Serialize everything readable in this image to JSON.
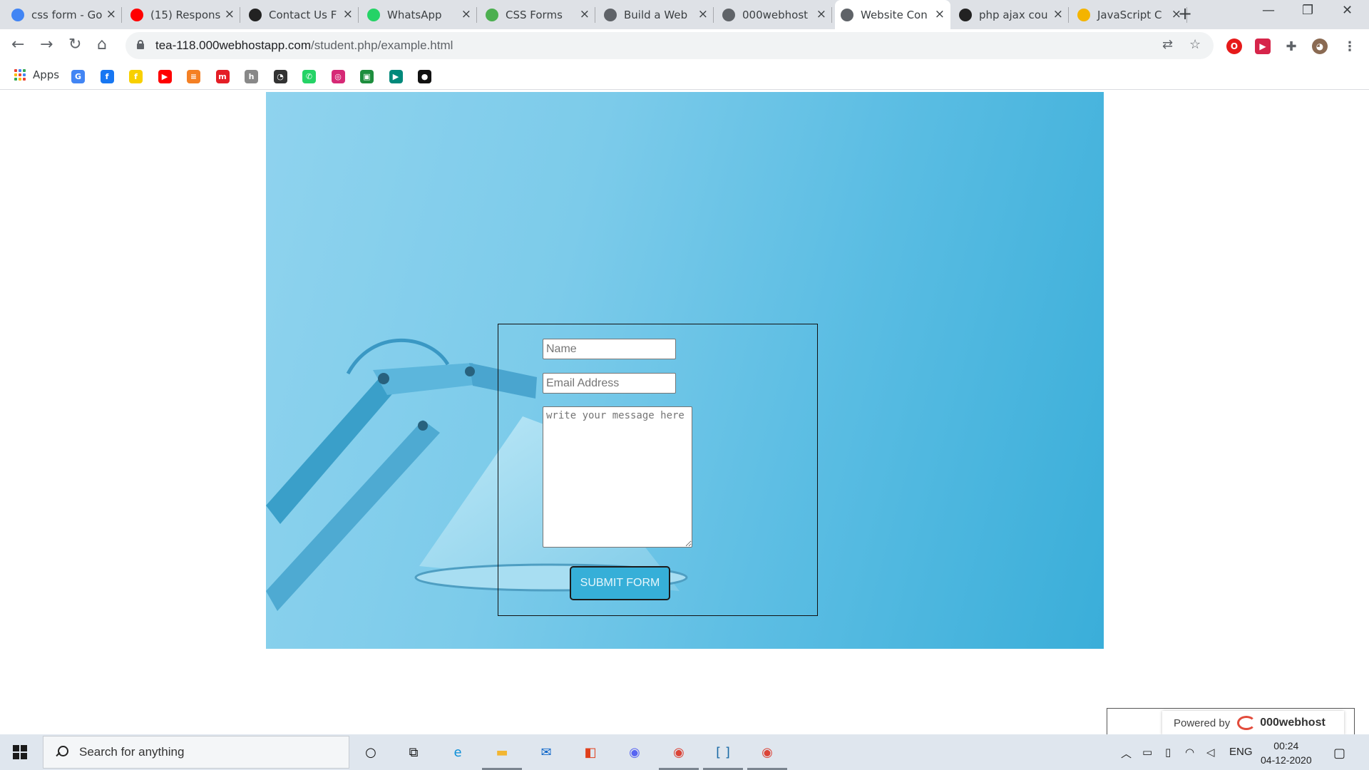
{
  "browser": {
    "tabs": [
      {
        "label": "css form - Go",
        "favicon": "google-icon",
        "color": "#4285f4"
      },
      {
        "label": "(15) Respons",
        "favicon": "youtube-icon",
        "color": "#ff0000"
      },
      {
        "label": "Contact Us F",
        "favicon": "codepen-icon",
        "color": "#222222"
      },
      {
        "label": "WhatsApp",
        "favicon": "whatsapp-icon",
        "color": "#25d366"
      },
      {
        "label": "CSS Forms",
        "favicon": "w3schools-icon",
        "color": "#4caf50"
      },
      {
        "label": "Build a Web",
        "favicon": "globe-icon",
        "color": "#5f6368"
      },
      {
        "label": "000webhost",
        "favicon": "globe-icon",
        "color": "#5f6368"
      },
      {
        "label": "Website Con",
        "favicon": "globe-icon",
        "color": "#5f6368",
        "active": true
      },
      {
        "label": "php ajax cou",
        "favicon": "r-logo-icon",
        "color": "#222222"
      },
      {
        "label": "JavaScript C",
        "favicon": "cloud-icon",
        "color": "#f4b400"
      }
    ],
    "new_tab": "+",
    "window_controls": {
      "minimize": "—",
      "maximize": "❐",
      "close": "✕"
    },
    "url": {
      "host": "tea-118.000webhostapp.com",
      "path": "/student.php/example.html"
    },
    "bookmarks": {
      "apps_label": "Apps",
      "items": [
        {
          "icon": "google-icon",
          "glyph": "G",
          "color": "#4285f4"
        },
        {
          "icon": "facebook-icon",
          "glyph": "f",
          "color": "#1877f2"
        },
        {
          "icon": "flipkart-icon",
          "glyph": "f",
          "color": "#f8d000"
        },
        {
          "icon": "youtube-icon",
          "glyph": "▶",
          "color": "#ff0000"
        },
        {
          "icon": "stack-icon",
          "glyph": "≡",
          "color": "#f48024"
        },
        {
          "icon": "myntra-icon",
          "glyph": "m",
          "color": "#e41e26"
        },
        {
          "icon": "hackerrank-icon",
          "glyph": "h",
          "color": "#888888"
        },
        {
          "icon": "speed-icon",
          "glyph": "◔",
          "color": "#333333"
        },
        {
          "icon": "whatsapp-icon",
          "glyph": "✆",
          "color": "#25d366"
        },
        {
          "icon": "instagram-icon",
          "glyph": "◎",
          "color": "#d62976"
        },
        {
          "icon": "classroom-icon",
          "glyph": "▣",
          "color": "#1e8e3e"
        },
        {
          "icon": "meet-icon",
          "glyph": "▶",
          "color": "#00897b"
        },
        {
          "icon": "github-icon",
          "glyph": "●",
          "color": "#111111"
        }
      ]
    }
  },
  "form": {
    "name_placeholder": "Name",
    "email_placeholder": "Email Address",
    "message_placeholder": "write your message here",
    "submit_label": "SUBMIT FORM"
  },
  "powered_by": {
    "prefix": "Powered by",
    "brand": "000webhost"
  },
  "taskbar": {
    "search_placeholder": "Search for anything",
    "apps": [
      {
        "name": "cortana-icon",
        "glyph": "○",
        "color": "#111111"
      },
      {
        "name": "task-view-icon",
        "glyph": "⧉",
        "color": "#111111"
      },
      {
        "name": "edge-icon",
        "glyph": "e",
        "color": "#0c8fd8"
      },
      {
        "name": "file-explorer-icon",
        "glyph": "▬",
        "color": "#f2b632"
      },
      {
        "name": "mail-icon",
        "glyph": "✉",
        "color": "#0a64c8"
      },
      {
        "name": "office-icon",
        "glyph": "◧",
        "color": "#e0401c"
      },
      {
        "name": "discord-icon",
        "glyph": "◉",
        "color": "#5865f2"
      },
      {
        "name": "chrome-icon",
        "glyph": "◉",
        "color": "#db4437"
      },
      {
        "name": "brackets-icon",
        "glyph": "[ ]",
        "color": "#1b6aa5"
      },
      {
        "name": "chrome-alt-icon",
        "glyph": "◉",
        "color": "#db4437"
      }
    ],
    "tray": {
      "language": "ENG",
      "time": "00:24",
      "date": "04-12-2020"
    }
  }
}
